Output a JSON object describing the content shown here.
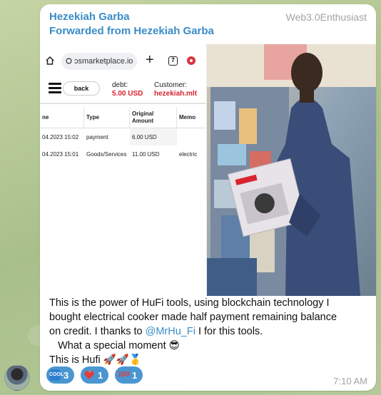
{
  "message": {
    "sender": "Hezekiah Garba",
    "forwarded_from": "Forwarded from Hezekiah Garba",
    "author_rank": "Web3.0Enthusiast",
    "time": "7:10 AM",
    "caption": {
      "line1": "This is the power of HuFi tools, using blockchain technology I",
      "line2": "bought electrical cooker made half payment remaining balance",
      "line3_prefix": "on credit. I thanks to ",
      "mention": "@MrHu_Fi",
      "line3_suffix": " I for this tools.",
      "line4": "   What a special moment 😎",
      "line5": "This is Hufi 🚀🚀🥇"
    },
    "reactions": [
      {
        "emoji": "cool-emoji",
        "count": "3"
      },
      {
        "emoji": "heart-on-fire-emoji",
        "count": "1"
      },
      {
        "emoji": "hundred-points-emoji",
        "count": "1"
      }
    ]
  },
  "screenshot": {
    "url": "ɔsmarketplace.io",
    "tab_count": "7",
    "back_label": "back",
    "debt_label": "debt:",
    "debt_value": "5.00 USD",
    "customer_label": "Customer:",
    "customer_value": "hezekiah.mlt",
    "table": {
      "headers": [
        "ne",
        "Type",
        "Original Amount",
        "Memo"
      ],
      "rows": [
        [
          "04.2023 15:02",
          "payment",
          "6.00 USD",
          ""
        ],
        [
          "04.2023 15:01",
          "Goods/Services",
          "11.00 USD",
          "electric"
        ]
      ]
    }
  },
  "colors": {
    "accent": "#3a8cc7",
    "debt_red": "#d8242f",
    "reaction_bg": "#4a96d1"
  }
}
